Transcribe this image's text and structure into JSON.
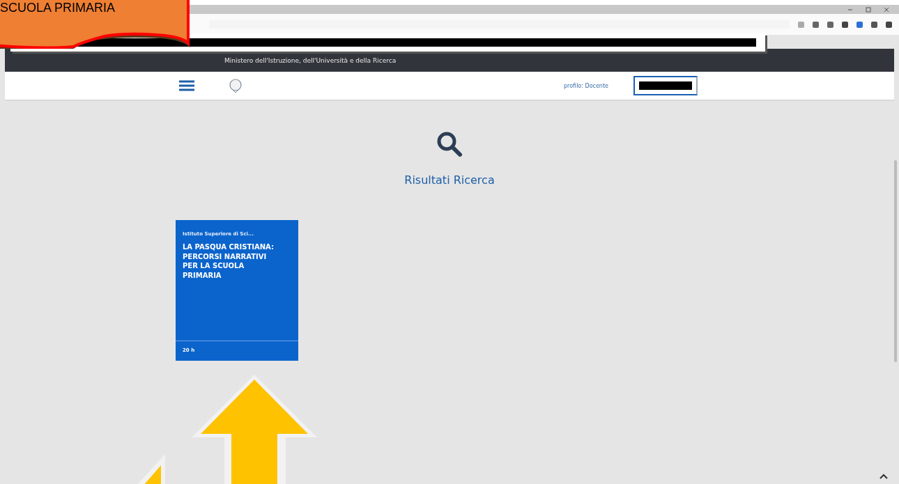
{
  "callout": {
    "text": "SCUOLA PRIMARIA"
  },
  "header": {
    "title": "Ministero dell'Istruzione, dell'Università e della Ricerca"
  },
  "nav": {
    "profile": "profilo: Docente"
  },
  "search": {
    "heading": "Risultati Ricerca"
  },
  "results": [
    {
      "institute": "Istituto Superiore di Sci...",
      "title": "LA PASQUA CRISTIANA: PERCORSI NARRATIVI PER LA SCUOLA PRIMARIA",
      "hours": "20 h"
    }
  ]
}
